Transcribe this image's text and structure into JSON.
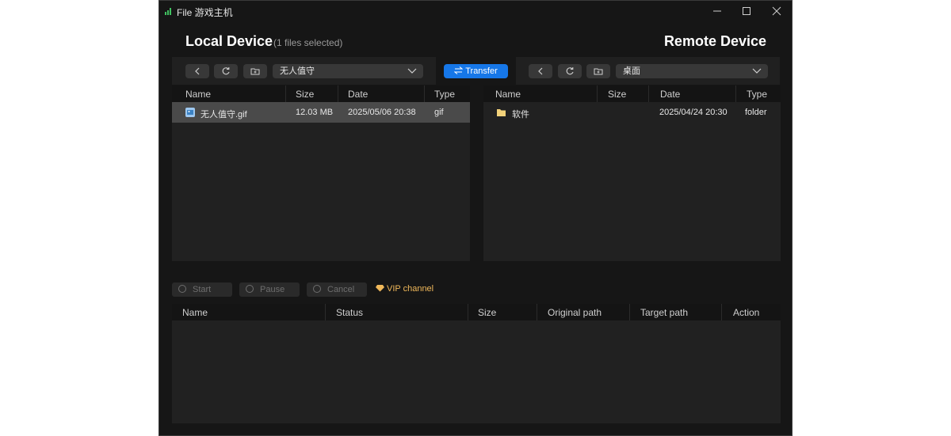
{
  "window": {
    "title": "File 游戏主机",
    "controls": [
      "minimize",
      "maximize",
      "close"
    ]
  },
  "local": {
    "heading": "Local Device",
    "selection_note": "(1 files selected)",
    "path": "无人值守",
    "columns": [
      "Name",
      "Size",
      "Date",
      "Type"
    ],
    "files": [
      {
        "name": "无人值守.gif",
        "size": "12.03 MB",
        "date": "2025/05/06 20:38",
        "type": "gif",
        "selected": true
      }
    ]
  },
  "transfer_label": "Transfer",
  "remote": {
    "heading": "Remote Device",
    "path": "桌面",
    "columns": [
      "Name",
      "Size",
      "Date",
      "Type"
    ],
    "files": [
      {
        "name": "软件",
        "size": "",
        "date": "2025/04/24 20:30",
        "type": "folder"
      }
    ]
  },
  "actions": {
    "start": "Start",
    "pause": "Pause",
    "cancel": "Cancel",
    "vip": "VIP channel"
  },
  "queue": {
    "columns": [
      "Name",
      "Status",
      "Size",
      "Original path",
      "Target path",
      "Action"
    ]
  },
  "colors": {
    "accent": "#1677e8",
    "vip": "#f0b85a",
    "selected_row": "#4a4a4a",
    "folder": "#f2d27a"
  }
}
